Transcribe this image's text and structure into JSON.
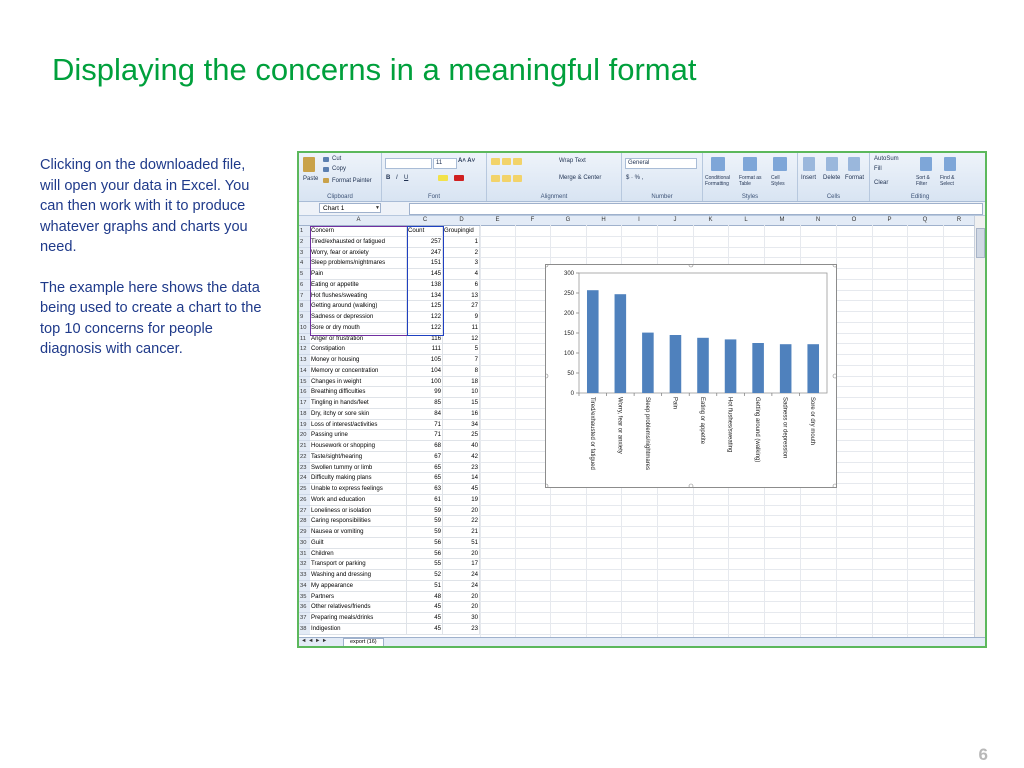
{
  "slide": {
    "title": "Displaying the concerns in a meaningful format",
    "paragraph1": "Clicking on the downloaded file, will open your data in Excel. You can then work with it to produce whatever graphs and charts you need.",
    "paragraph2": "The example here shows the data being used to create a chart to the top 10 concerns for people diagnosis with cancer.",
    "page_number": "6"
  },
  "excel": {
    "ribbon": {
      "clipboard": {
        "paste": "Paste",
        "cut": "Cut",
        "copy": "Copy",
        "format_painter": "Format Painter",
        "label": "Clipboard"
      },
      "font": {
        "font_name": "",
        "font_size": "11",
        "label": "Font"
      },
      "alignment": {
        "wrap_text": "Wrap Text",
        "merge_center": "Merge & Center",
        "label": "Alignment"
      },
      "number": {
        "format": "General",
        "label": "Number"
      },
      "styles": {
        "conditional": "Conditional Formatting",
        "format_table": "Format as Table",
        "cell_styles": "Cell Styles",
        "label": "Styles"
      },
      "cells": {
        "insert": "Insert",
        "delete": "Delete",
        "format": "Format",
        "label": "Cells"
      },
      "editing": {
        "autosum": "AutoSum",
        "fill": "Fill",
        "clear": "Clear",
        "sort_filter": "Sort & Filter",
        "find_select": "Find & Select",
        "label": "Editing"
      }
    },
    "name_box": "Chart 1",
    "columns": [
      "A",
      "C",
      "D",
      "E",
      "F",
      "G",
      "H",
      "I",
      "J",
      "K",
      "L",
      "M",
      "N",
      "O",
      "P",
      "Q",
      "R"
    ],
    "headers": {
      "concern": "Concern",
      "count": "Count",
      "groupingid": "Groupingid"
    },
    "rows": [
      {
        "n": "1",
        "concern": "Concern",
        "count": "Count",
        "gid": "Groupingid"
      },
      {
        "n": "2",
        "concern": "Tired/exhausted or fatigued",
        "count": "257",
        "gid": "1"
      },
      {
        "n": "3",
        "concern": "Worry, fear or anxiety",
        "count": "247",
        "gid": "2"
      },
      {
        "n": "4",
        "concern": "Sleep problems/nightmares",
        "count": "151",
        "gid": "3"
      },
      {
        "n": "5",
        "concern": "Pain",
        "count": "145",
        "gid": "4"
      },
      {
        "n": "6",
        "concern": "Eating or appetite",
        "count": "138",
        "gid": "6"
      },
      {
        "n": "7",
        "concern": "Hot flushes/sweating",
        "count": "134",
        "gid": "13"
      },
      {
        "n": "8",
        "concern": "Getting around (walking)",
        "count": "125",
        "gid": "27"
      },
      {
        "n": "9",
        "concern": "Sadness or depression",
        "count": "122",
        "gid": "9"
      },
      {
        "n": "10",
        "concern": "Sore or dry mouth",
        "count": "122",
        "gid": "11"
      },
      {
        "n": "11",
        "concern": "Anger or frustration",
        "count": "116",
        "gid": "12"
      },
      {
        "n": "12",
        "concern": "Constipation",
        "count": "111",
        "gid": "5"
      },
      {
        "n": "13",
        "concern": "Money or housing",
        "count": "105",
        "gid": "7"
      },
      {
        "n": "14",
        "concern": "Memory or concentration",
        "count": "104",
        "gid": "8"
      },
      {
        "n": "15",
        "concern": "Changes in weight",
        "count": "100",
        "gid": "18"
      },
      {
        "n": "16",
        "concern": "Breathing difficulties",
        "count": "99",
        "gid": "10"
      },
      {
        "n": "17",
        "concern": "Tingling in hands/feet",
        "count": "85",
        "gid": "15"
      },
      {
        "n": "18",
        "concern": "Dry, itchy or sore skin",
        "count": "84",
        "gid": "16"
      },
      {
        "n": "19",
        "concern": "Loss of interest/activities",
        "count": "71",
        "gid": "34"
      },
      {
        "n": "20",
        "concern": "Passing urine",
        "count": "71",
        "gid": "25"
      },
      {
        "n": "21",
        "concern": "Housework or shopping",
        "count": "68",
        "gid": "40"
      },
      {
        "n": "22",
        "concern": "Taste/sight/hearing",
        "count": "67",
        "gid": "42"
      },
      {
        "n": "23",
        "concern": "Swollen tummy or limb",
        "count": "65",
        "gid": "23"
      },
      {
        "n": "24",
        "concern": "Difficulty making plans",
        "count": "65",
        "gid": "14"
      },
      {
        "n": "25",
        "concern": "Unable to express feelings",
        "count": "63",
        "gid": "45"
      },
      {
        "n": "26",
        "concern": "Work and education",
        "count": "61",
        "gid": "19"
      },
      {
        "n": "27",
        "concern": "Loneliness or isolation",
        "count": "59",
        "gid": "20"
      },
      {
        "n": "28",
        "concern": "Caring responsibilities",
        "count": "59",
        "gid": "22"
      },
      {
        "n": "29",
        "concern": "Nausea or vomiting",
        "count": "59",
        "gid": "21"
      },
      {
        "n": "30",
        "concern": "Guilt",
        "count": "56",
        "gid": "51"
      },
      {
        "n": "31",
        "concern": "Children",
        "count": "56",
        "gid": "20"
      },
      {
        "n": "32",
        "concern": "Transport or parking",
        "count": "55",
        "gid": "17"
      },
      {
        "n": "33",
        "concern": "Washing and dressing",
        "count": "52",
        "gid": "24"
      },
      {
        "n": "34",
        "concern": "My appearance",
        "count": "51",
        "gid": "24"
      },
      {
        "n": "35",
        "concern": "Partners",
        "count": "48",
        "gid": "20"
      },
      {
        "n": "36",
        "concern": "Other relatives/friends",
        "count": "45",
        "gid": "20"
      },
      {
        "n": "37",
        "concern": "Preparing meals/drinks",
        "count": "45",
        "gid": "30"
      },
      {
        "n": "38",
        "concern": "Indigestion",
        "count": "45",
        "gid": "23"
      }
    ],
    "sheet_tab": "export (16)"
  },
  "chart_data": {
    "type": "bar",
    "categories": [
      "Tired/exhausted or fatigued",
      "Worry, fear or anxiety",
      "Sleep problems/nightmares",
      "Pain",
      "Eating or appetite",
      "Hot flushes/sweating",
      "Getting around (walking)",
      "Sadness or depression",
      "Sore or dry mouth"
    ],
    "values": [
      257,
      247,
      151,
      145,
      138,
      134,
      125,
      122,
      122
    ],
    "y_ticks": [
      "0",
      "50",
      "100",
      "150",
      "200",
      "250",
      "300"
    ],
    "ylim": [
      0,
      300
    ],
    "bar_color": "#4f81bd",
    "grid": false
  },
  "colors": {
    "title_green": "#00a03c",
    "text_blue": "#1f3a8a",
    "frame_green": "#5cb85c"
  }
}
